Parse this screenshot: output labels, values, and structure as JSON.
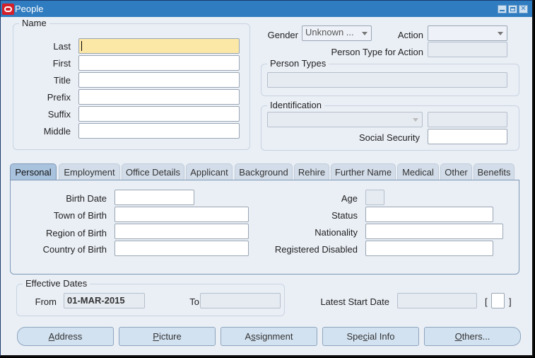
{
  "window": {
    "title": "People",
    "controls": [
      "minimize",
      "maximize",
      "close"
    ]
  },
  "name_group": {
    "legend": "Name",
    "fields": [
      {
        "label": "Last",
        "value": "",
        "focused": true
      },
      {
        "label": "First",
        "value": ""
      },
      {
        "label": "Title",
        "value": ""
      },
      {
        "label": "Prefix",
        "value": ""
      },
      {
        "label": "Suffix",
        "value": ""
      },
      {
        "label": "Middle",
        "value": ""
      }
    ]
  },
  "header": {
    "gender_label": "Gender",
    "gender_value": "Unknown ...",
    "action_label": "Action",
    "action_value": "",
    "person_type_for_action_label": "Person Type for Action",
    "person_type_for_action_value": ""
  },
  "person_types": {
    "legend": "Person Types",
    "value": ""
  },
  "identification": {
    "legend": "Identification",
    "type_value": "",
    "number_value": "",
    "social_security_label": "Social Security",
    "social_security_value": ""
  },
  "tabs": [
    {
      "label": "Personal",
      "active": true
    },
    {
      "label": "Employment"
    },
    {
      "label": "Office Details"
    },
    {
      "label": "Applicant"
    },
    {
      "label": "Background"
    },
    {
      "label": "Rehire"
    },
    {
      "label": "Further Name"
    },
    {
      "label": "Medical"
    },
    {
      "label": "Other"
    },
    {
      "label": "Benefits"
    }
  ],
  "personal": {
    "birth_date_label": "Birth Date",
    "birth_date_value": "",
    "town_of_birth_label": "Town of Birth",
    "town_of_birth_value": "",
    "region_of_birth_label": "Region of Birth",
    "region_of_birth_value": "",
    "country_of_birth_label": "Country of Birth",
    "country_of_birth_value": "",
    "age_label": "Age",
    "age_value": "",
    "status_label": "Status",
    "status_value": "",
    "nationality_label": "Nationality",
    "nationality_value": "",
    "registered_disabled_label": "Registered Disabled",
    "registered_disabled_value": ""
  },
  "effective_dates": {
    "legend": "Effective Dates",
    "from_label": "From",
    "from_value": "01-MAR-2015",
    "to_label": "To",
    "to_value": ""
  },
  "latest_start": {
    "label": "Latest Start Date",
    "value": "",
    "bracket_open": "[",
    "bracket_close": "]"
  },
  "buttons": [
    {
      "label": "Address",
      "mnemonic": "A"
    },
    {
      "label": "Picture",
      "mnemonic": "P"
    },
    {
      "label": "Assignment",
      "mnemonic": "s"
    },
    {
      "label": "Special Info",
      "mnemonic": "c"
    },
    {
      "label": "Others...",
      "mnemonic": "O"
    }
  ]
}
